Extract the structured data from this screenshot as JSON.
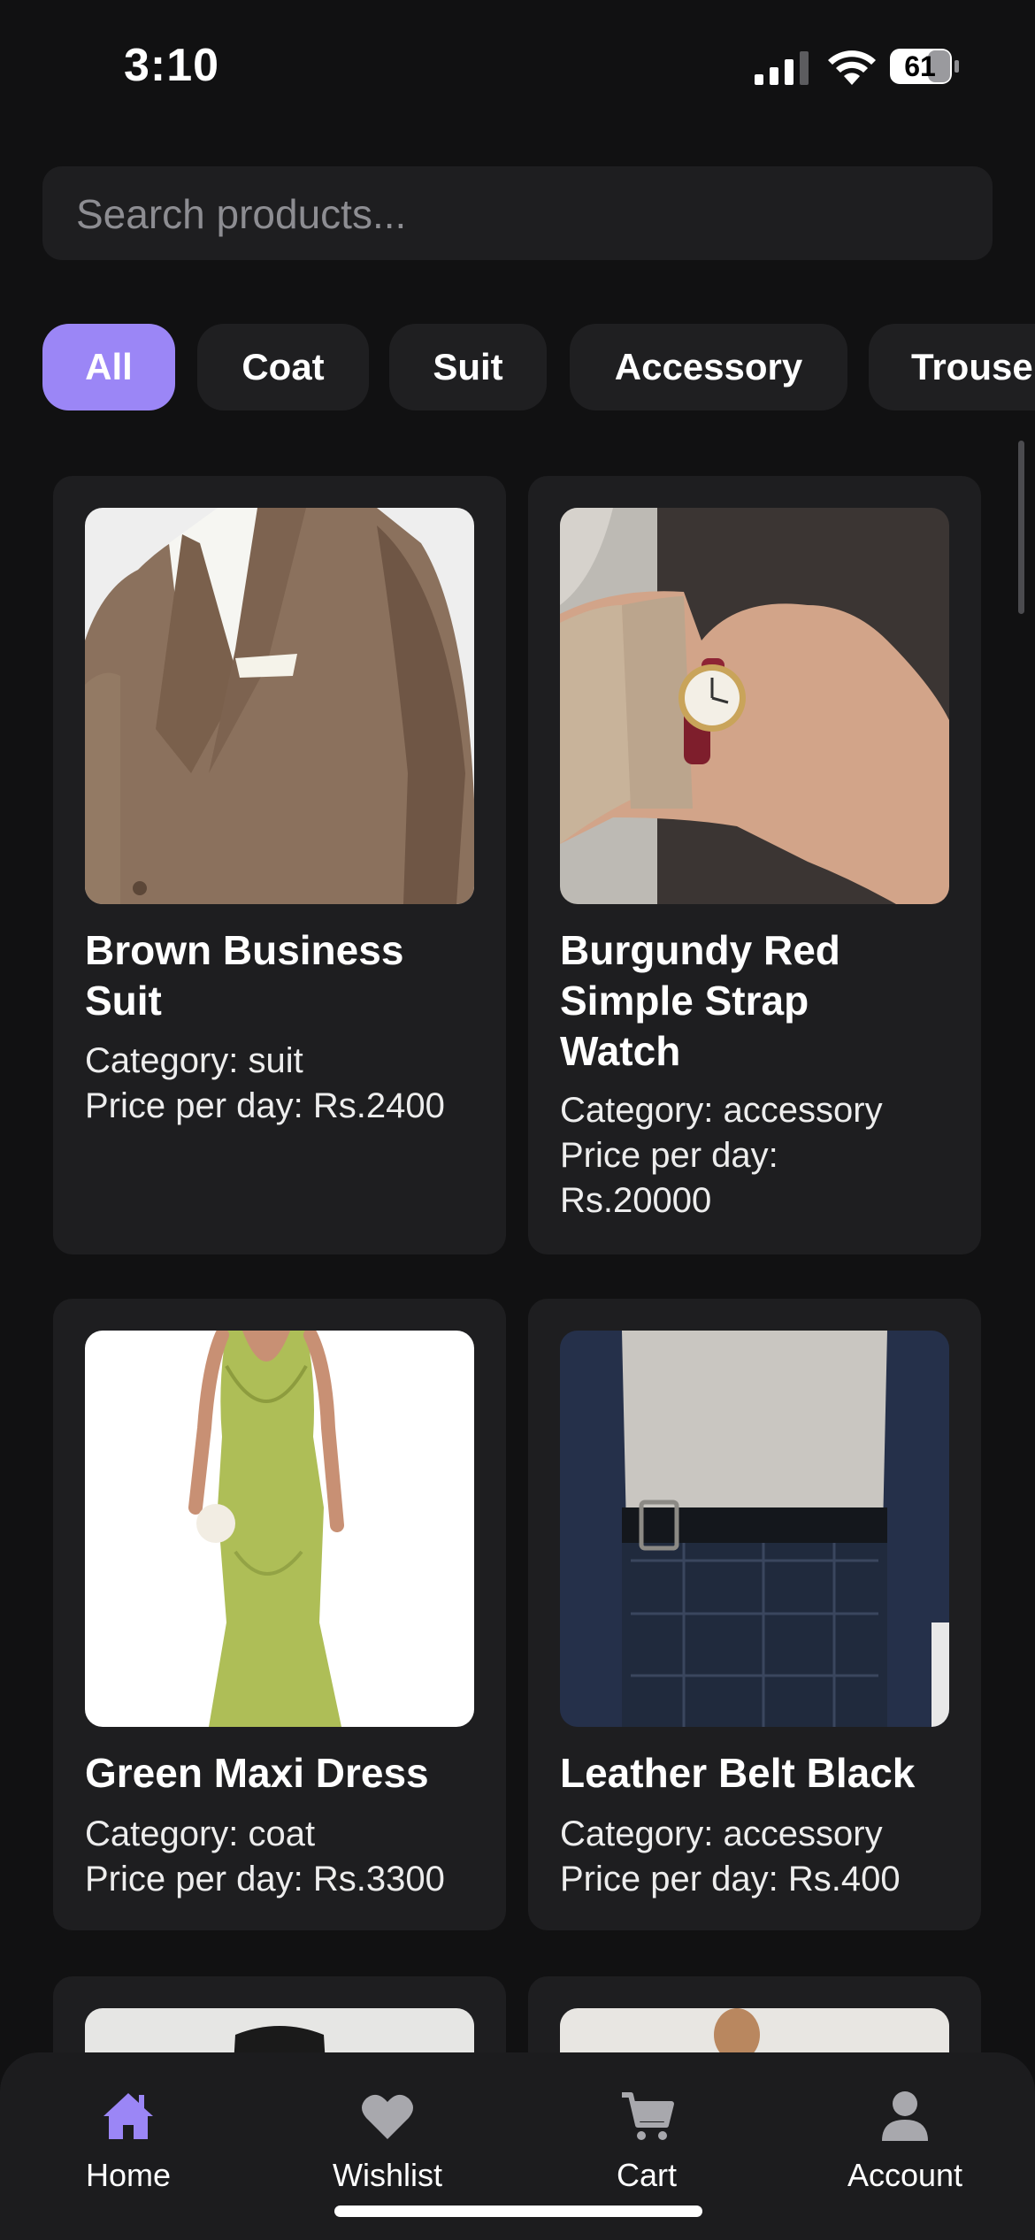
{
  "status_bar": {
    "time": "3:10",
    "battery": "61"
  },
  "search": {
    "placeholder": "Search products..."
  },
  "filters": {
    "chips": [
      "All",
      "Coat",
      "Suit",
      "Accessory",
      "Trouse"
    ],
    "active": "All"
  },
  "products": [
    {
      "title_lines": [
        "Brown Business",
        "Suit"
      ],
      "category": "Category: suit",
      "price_lines": [
        "Price per day: Rs.2400"
      ]
    },
    {
      "title_lines": [
        "Burgundy Red",
        "Simple Strap",
        "Watch"
      ],
      "category": "Category: accessory",
      "price_lines": [
        "Price per day:",
        "Rs.20000"
      ]
    },
    {
      "title_lines": [
        "Green Maxi Dress"
      ],
      "category": "Category: coat",
      "price_lines": [
        "Price per day: Rs.3300"
      ]
    },
    {
      "title_lines": [
        "Leather Belt Black"
      ],
      "category": "Category: accessory",
      "price_lines": [
        "Price per day: Rs.400"
      ]
    }
  ],
  "tabbar": {
    "tabs": [
      {
        "label": "Home",
        "icon": "home-icon",
        "active": true
      },
      {
        "label": "Wishlist",
        "icon": "heart-icon",
        "active": false
      },
      {
        "label": "Cart",
        "icon": "cart-icon",
        "active": false
      },
      {
        "label": "Account",
        "icon": "person-icon",
        "active": false
      }
    ]
  },
  "colors": {
    "accent": "#9b86f6",
    "background": "#111112",
    "card": "#1e1e20",
    "inactive_icon": "#a8a8ad"
  }
}
